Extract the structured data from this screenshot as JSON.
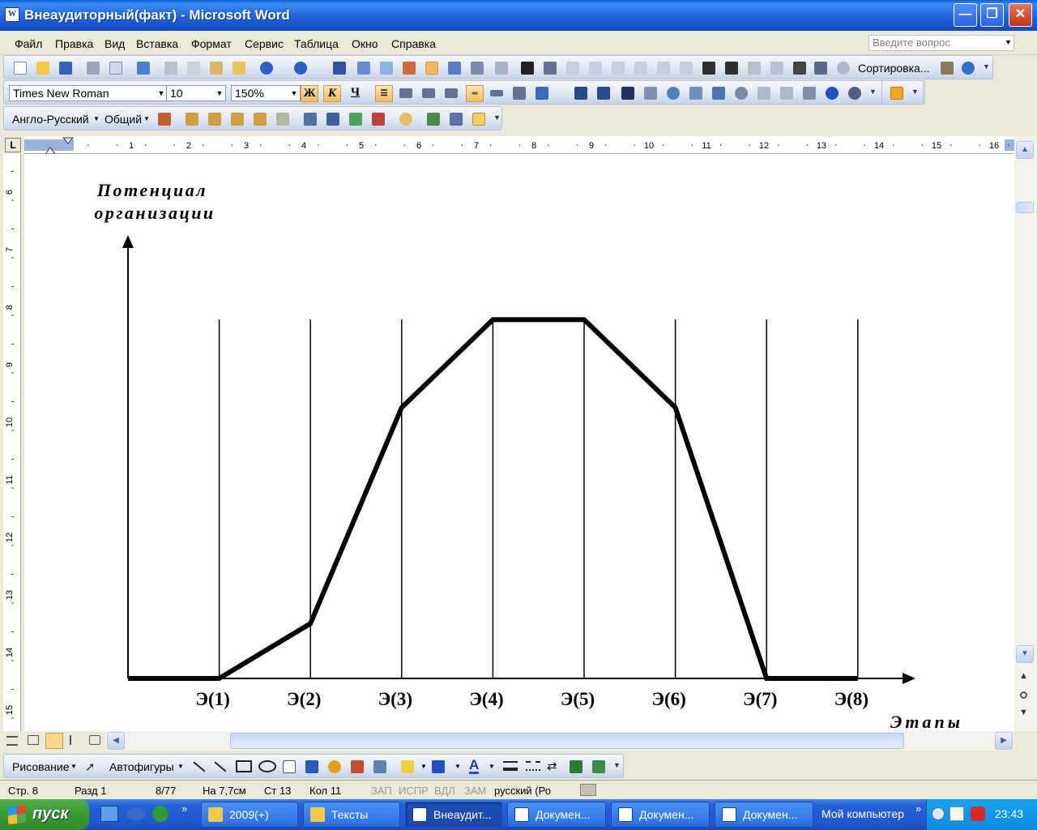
{
  "window": {
    "title": "Внеаудиторный(факт) - Microsoft Word",
    "app_icon_letter": "W",
    "min_glyph": "—",
    "max_glyph": "❐",
    "close_glyph": "✕"
  },
  "menu": {
    "items": [
      "Файл",
      "Правка",
      "Вид",
      "Вставка",
      "Формат",
      "Сервис",
      "Таблица",
      "Окно",
      "Справка"
    ],
    "help_placeholder": "Введите вопрос"
  },
  "toolbar_standard": {
    "sort_label": "Сортировка..."
  },
  "toolbar_formatting": {
    "font": "Times New Roman",
    "size": "10",
    "zoom": "150%",
    "bold_label": "Ж",
    "italic_label": "К",
    "underline_label": "Ч"
  },
  "toolbar_translate": {
    "dictionary": "Англо-Русский",
    "subject": "Общий"
  },
  "ruler": {
    "corner_label": "L",
    "h_numbers": [
      "1",
      "2",
      "3",
      "4",
      "5",
      "6",
      "7",
      "8",
      "9",
      "10",
      "11",
      "12",
      "13",
      "14",
      "15",
      "16"
    ],
    "v_numbers": [
      "6",
      "7",
      "8",
      "9",
      "10",
      "11",
      "12",
      "13",
      "14",
      "15"
    ]
  },
  "document": {
    "y_label_line1": "Потенциал",
    "y_label_line2": "организации",
    "x_label": "Этапы"
  },
  "chart_data": {
    "type": "line",
    "title": "",
    "ylabel": "Потенциал организации",
    "xlabel": "Этапы",
    "categories": [
      "Э(1)",
      "Э(2)",
      "Э(3)",
      "Э(4)",
      "Э(5)",
      "Э(6)",
      "Э(7)",
      "Э(8)"
    ],
    "series": [
      {
        "x": [
          0,
          1,
          2,
          3,
          4,
          5,
          6,
          7,
          8
        ],
        "values": [
          0,
          0,
          1.5,
          7.4,
          9.8,
          9.8,
          7.4,
          0,
          0
        ]
      }
    ],
    "ylim": [
      0,
      12
    ],
    "grid": "vertical lines at each stage",
    "legend": "none"
  },
  "drawbar": {
    "draw_label": "Рисование",
    "autoshapes_label": "Автофигуры"
  },
  "status": {
    "page": "Стр. 8",
    "section": "Разд 1",
    "pages": "8/77",
    "at": "На 7,7см",
    "line": "Ст 13",
    "col": "Кол 11",
    "rec": "ЗАП",
    "trk": "ИСПР",
    "ext": "ВДЛ",
    "ovr": "ЗАМ",
    "lang": "русский (Ро"
  },
  "taskbar": {
    "start_label": "пуск",
    "tasks": [
      "2009(+)",
      "Тексты",
      "Внеаудит...",
      "Докумен...",
      "Докумен...",
      "Докумен..."
    ],
    "my_computer": "Мой компьютер",
    "chevron": "»",
    "clock": "23:43"
  },
  "colors": {
    "xp_blue": "#245edb",
    "start_green": "#3a9d33",
    "ui_bg": "#ece9d8",
    "toolbar_blue": "#dfe6f3"
  }
}
